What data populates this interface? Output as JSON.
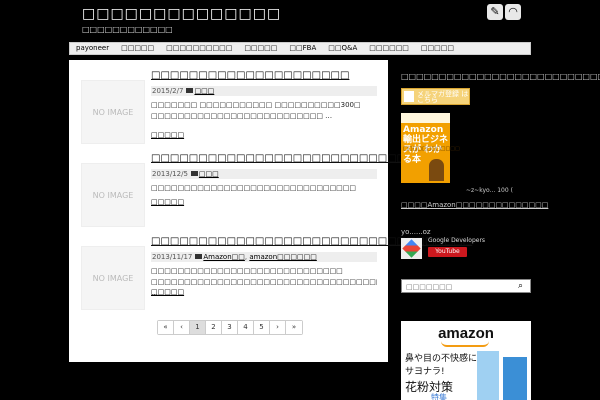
{
  "header": {
    "site_title": "□□□□□□□□□□□□□□",
    "site_description": "□□□□□□□□□□□□",
    "icons": [
      "feedly-icon",
      "rss-icon"
    ]
  },
  "nav": {
    "items": [
      "payoneer",
      "□□□□□",
      "□□□□□□□□□□",
      "□□□□□",
      "□□FBA",
      "□□Q&A",
      "□□□□□□",
      "□□□□□"
    ]
  },
  "posts": [
    {
      "thumb": "NO IMAGE",
      "title": "□□□□□□□□□□□□□□□□□□□□□",
      "date": "2015/2/7",
      "categories": [
        "□□□"
      ],
      "excerpt": "□□□□□□□ □□□□□□□□□□□ □□□□□□□□□□300□ □□□□□□□□□□□□□□□□□□□□□□□□□□ …",
      "more": "□□□□□"
    },
    {
      "thumb": "NO IMAGE",
      "title": "□□□□□□□□□□□□□□□□□□□□□□□□□□□□□",
      "date": "2013/12/5",
      "categories": [
        "□□□"
      ],
      "excerpt": "□□□□□□□□□□□□□□□□□□□□□□□□□□□□□□□",
      "more": "□□□□□"
    },
    {
      "thumb": "NO IMAGE",
      "title": "□□□□□□□□□□□□□□□□□□□□□□□□□□□□□□□□□□",
      "date": "2013/11/17",
      "categories": [
        "Amazon□□",
        "amazon□□□□□□"
      ],
      "excerpt": "□□□□□□□□□□□□□□□□□□□□□□□□□□□□□ □□□□□□□□□□□□□□□□□□□□□□□□□□□□□□□□□□□□□□□□□□□□□ …",
      "more": "□□□□□"
    }
  ],
  "pagination": [
    "«",
    "‹",
    "1",
    "2",
    "3",
    "4",
    "5",
    "›",
    "»"
  ],
  "pagination_current": "1",
  "sidebar": {
    "widget_title": "□□□□□□□□□□□□□□□□□□□□□□□□□□□",
    "melmaga_banner": "メルマガ登録 はこちら",
    "book": {
      "title": "Amazon 輸出ビジネスが わかる本",
      "subtitle": "□□□□□□□□□□□□"
    },
    "book_caption": "~z~kyo... 100 (",
    "amazon_link": "□□□□Amazon□□□□□□□□□□□□□□",
    "youtube_title": "yo......oz",
    "youtube_channel": "Google Developers",
    "youtube_button": "YouTube",
    "search_placeholder": "□□□□□□□",
    "ad": {
      "logo": "amazon",
      "line1": "鼻や目の不快感に",
      "line2": "サヨナラ!",
      "line3": "花粉対策",
      "line4": "特集"
    }
  }
}
